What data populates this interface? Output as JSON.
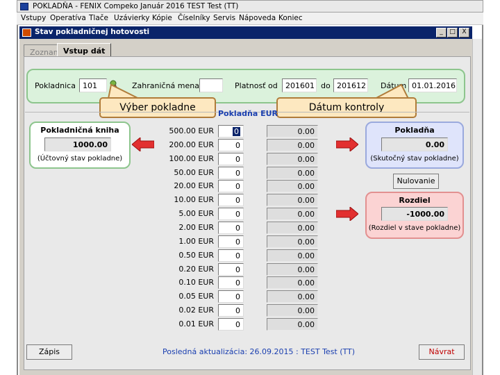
{
  "app": {
    "title": "POKLADŇA - FENIX Compeko  Január 2016  TEST Test  (TT)"
  },
  "menu": [
    "Vstupy",
    "Operatíva",
    "Tlače",
    "Uzávierky",
    "Kópie",
    "Číselníky",
    "Servis",
    "Nápoveda",
    "Koniec"
  ],
  "window": {
    "title": "Stav pokladničnej hotovosti",
    "min": "_",
    "max": "□",
    "close": "X"
  },
  "tabs": {
    "list": "Zoznam",
    "input": "Vstup dát"
  },
  "header": {
    "pokladnica_label": "Pokladnica",
    "pokladnica_value": "101",
    "zahranicna_label": "Zahraničná mena",
    "zahranicna_value": "",
    "platnost_label": "Platnosť od",
    "platnost_od": "201601",
    "do_label": "do",
    "platnost_do": "201612",
    "datum_label": "Dátum",
    "datum_value": "01.01.2016"
  },
  "callouts": {
    "left": "Výber pokladne",
    "right": "Dátum kontroly"
  },
  "section_title": "Pokladňa EUR",
  "kniha": {
    "title": "Pokladničná kniha",
    "value": "1000.00",
    "note": "(Účtovný stav pokladne)"
  },
  "pokladna": {
    "title": "Pokladňa",
    "value": "0.00",
    "note": "(Skutočný stav pokladne)"
  },
  "nulovanie": "Nulovanie",
  "rozdiel": {
    "title": "Rozdiel",
    "value": "-1000.00",
    "note": "(Rozdiel v stave pokladne)"
  },
  "denominations": [
    {
      "label": "500.00  EUR",
      "qty": "0",
      "amount": "0.00"
    },
    {
      "label": "200.00  EUR",
      "qty": "0",
      "amount": "0.00"
    },
    {
      "label": "100.00  EUR",
      "qty": "0",
      "amount": "0.00"
    },
    {
      "label": "50.00  EUR",
      "qty": "0",
      "amount": "0.00"
    },
    {
      "label": "20.00  EUR",
      "qty": "0",
      "amount": "0.00"
    },
    {
      "label": "10.00  EUR",
      "qty": "0",
      "amount": "0.00"
    },
    {
      "label": "5.00  EUR",
      "qty": "0",
      "amount": "0.00"
    },
    {
      "label": "2.00  EUR",
      "qty": "0",
      "amount": "0.00"
    },
    {
      "label": "1.00  EUR",
      "qty": "0",
      "amount": "0.00"
    },
    {
      "label": "0.50  EUR",
      "qty": "0",
      "amount": "0.00"
    },
    {
      "label": "0.20  EUR",
      "qty": "0",
      "amount": "0.00"
    },
    {
      "label": "0.10  EUR",
      "qty": "0",
      "amount": "0.00"
    },
    {
      "label": "0.05  EUR",
      "qty": "0",
      "amount": "0.00"
    },
    {
      "label": "0.02  EUR",
      "qty": "0",
      "amount": "0.00"
    },
    {
      "label": "0.01  EUR",
      "qty": "0",
      "amount": "0.00"
    }
  ],
  "footer": {
    "zapis": "Zápis",
    "last_update": "Posledná aktualizácia: 26.09.2015 : TEST Test  (TT)",
    "navrat": "Návrat"
  },
  "colors": {
    "accent_blue": "#1a3fb0",
    "arrow_red": "#e23030",
    "titlebar": "#0a246a",
    "navrat_text": "#c00000"
  }
}
